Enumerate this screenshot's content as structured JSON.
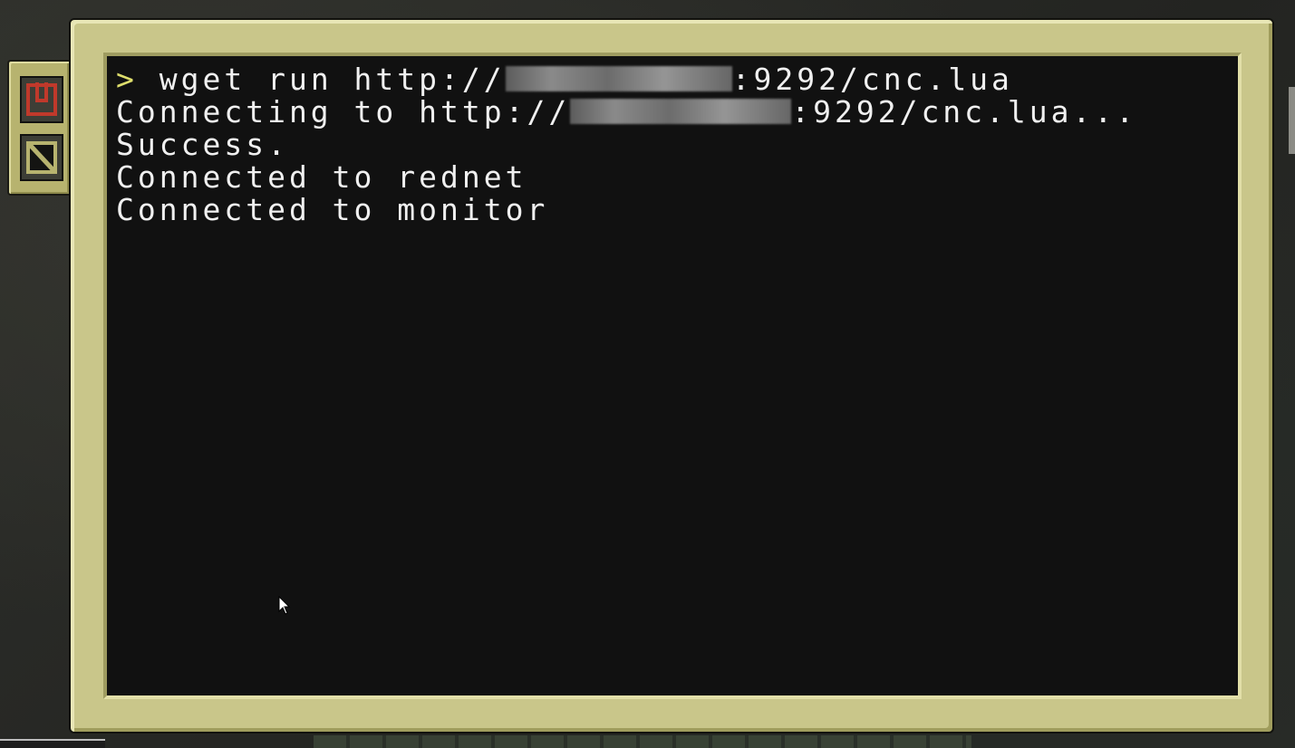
{
  "side_tabs": {
    "power_icon": "power-icon",
    "terminate_icon": "terminate-icon",
    "power_color": "#c0392b"
  },
  "terminal": {
    "prompt_symbol": ">",
    "line1_cmd": " wget run http://",
    "line1_tail": ":9292/cnc.lua",
    "line2_head": "Connecting to http://",
    "line2_tail": ":9292/cnc.lua...",
    "line3": "Success.",
    "line4": "Connected to rednet",
    "line5": "Connected to monitor",
    "text_color": "#f0f0f0",
    "prompt_color": "#dede6c",
    "background_color": "#111111"
  },
  "frame": {
    "color": "#c9c68a"
  }
}
